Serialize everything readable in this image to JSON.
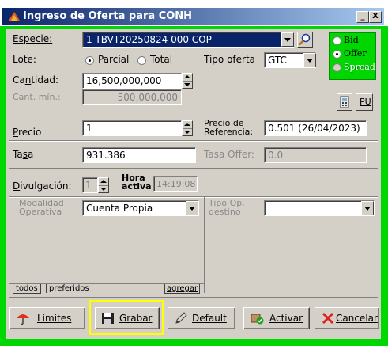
{
  "window": {
    "title": "Ingreso de Oferta para CONH",
    "minimize_label": "_",
    "close_label": "X"
  },
  "form": {
    "especie_label": "Especie:",
    "especie_value": "1 TBVT20250824 000 COP",
    "side_options": [
      {
        "label": "Bid",
        "selected": false
      },
      {
        "label": "Offer",
        "selected": true
      },
      {
        "label": "Spread",
        "selected": false,
        "disabled": true
      }
    ],
    "lote_label": "Lote:",
    "lote_options": [
      {
        "label": "Parcial",
        "selected": true
      },
      {
        "label": "Total",
        "selected": false
      }
    ],
    "tipo_oferta_label": "Tipo oferta",
    "tipo_oferta_value": "GTC",
    "cantidad_label": "Cantidad:",
    "cantidad_value": "16,500,000,000",
    "cant_min_label": "Cant. mín.:",
    "cant_min_value": "500,000,000",
    "pu_label": "PU",
    "precio_label": "Precio",
    "precio_value": "1",
    "precio_ref_label_1": "Precio de",
    "precio_ref_label_2": "Referencia:",
    "precio_ref_value": "0.501 (26/04/2023)",
    "tasa_label": "Tasa",
    "tasa_value": "931.386",
    "tasa_offer_label": "Tasa Offer:",
    "tasa_offer_value": "0.0",
    "divulgacion_label": "Divulgación:",
    "divulgacion_value": "1",
    "hora_activa_label_1": "Hora",
    "hora_activa_label_2": "activa",
    "hora_activa_value": "14:19:08",
    "modalidad_label_1": "Modalidad",
    "modalidad_label_2": "Operativa",
    "modalidad_value": "Cuenta Propia",
    "tipo_op_label_1": "Tipo Op.",
    "tipo_op_label_2": "destino",
    "tipo_op_value": ""
  },
  "tabs": {
    "todos": "todos",
    "preferidos": "preferidos",
    "agregar": "agregar"
  },
  "buttons": {
    "limites": "Límites",
    "grabar": "Grabar",
    "default": "Default",
    "activar": "Activar",
    "cancelar": "Cancelar"
  },
  "colors": {
    "frame": "#00d600",
    "highlight": "#ffff00",
    "title_gradient_start": "#0a246a"
  }
}
